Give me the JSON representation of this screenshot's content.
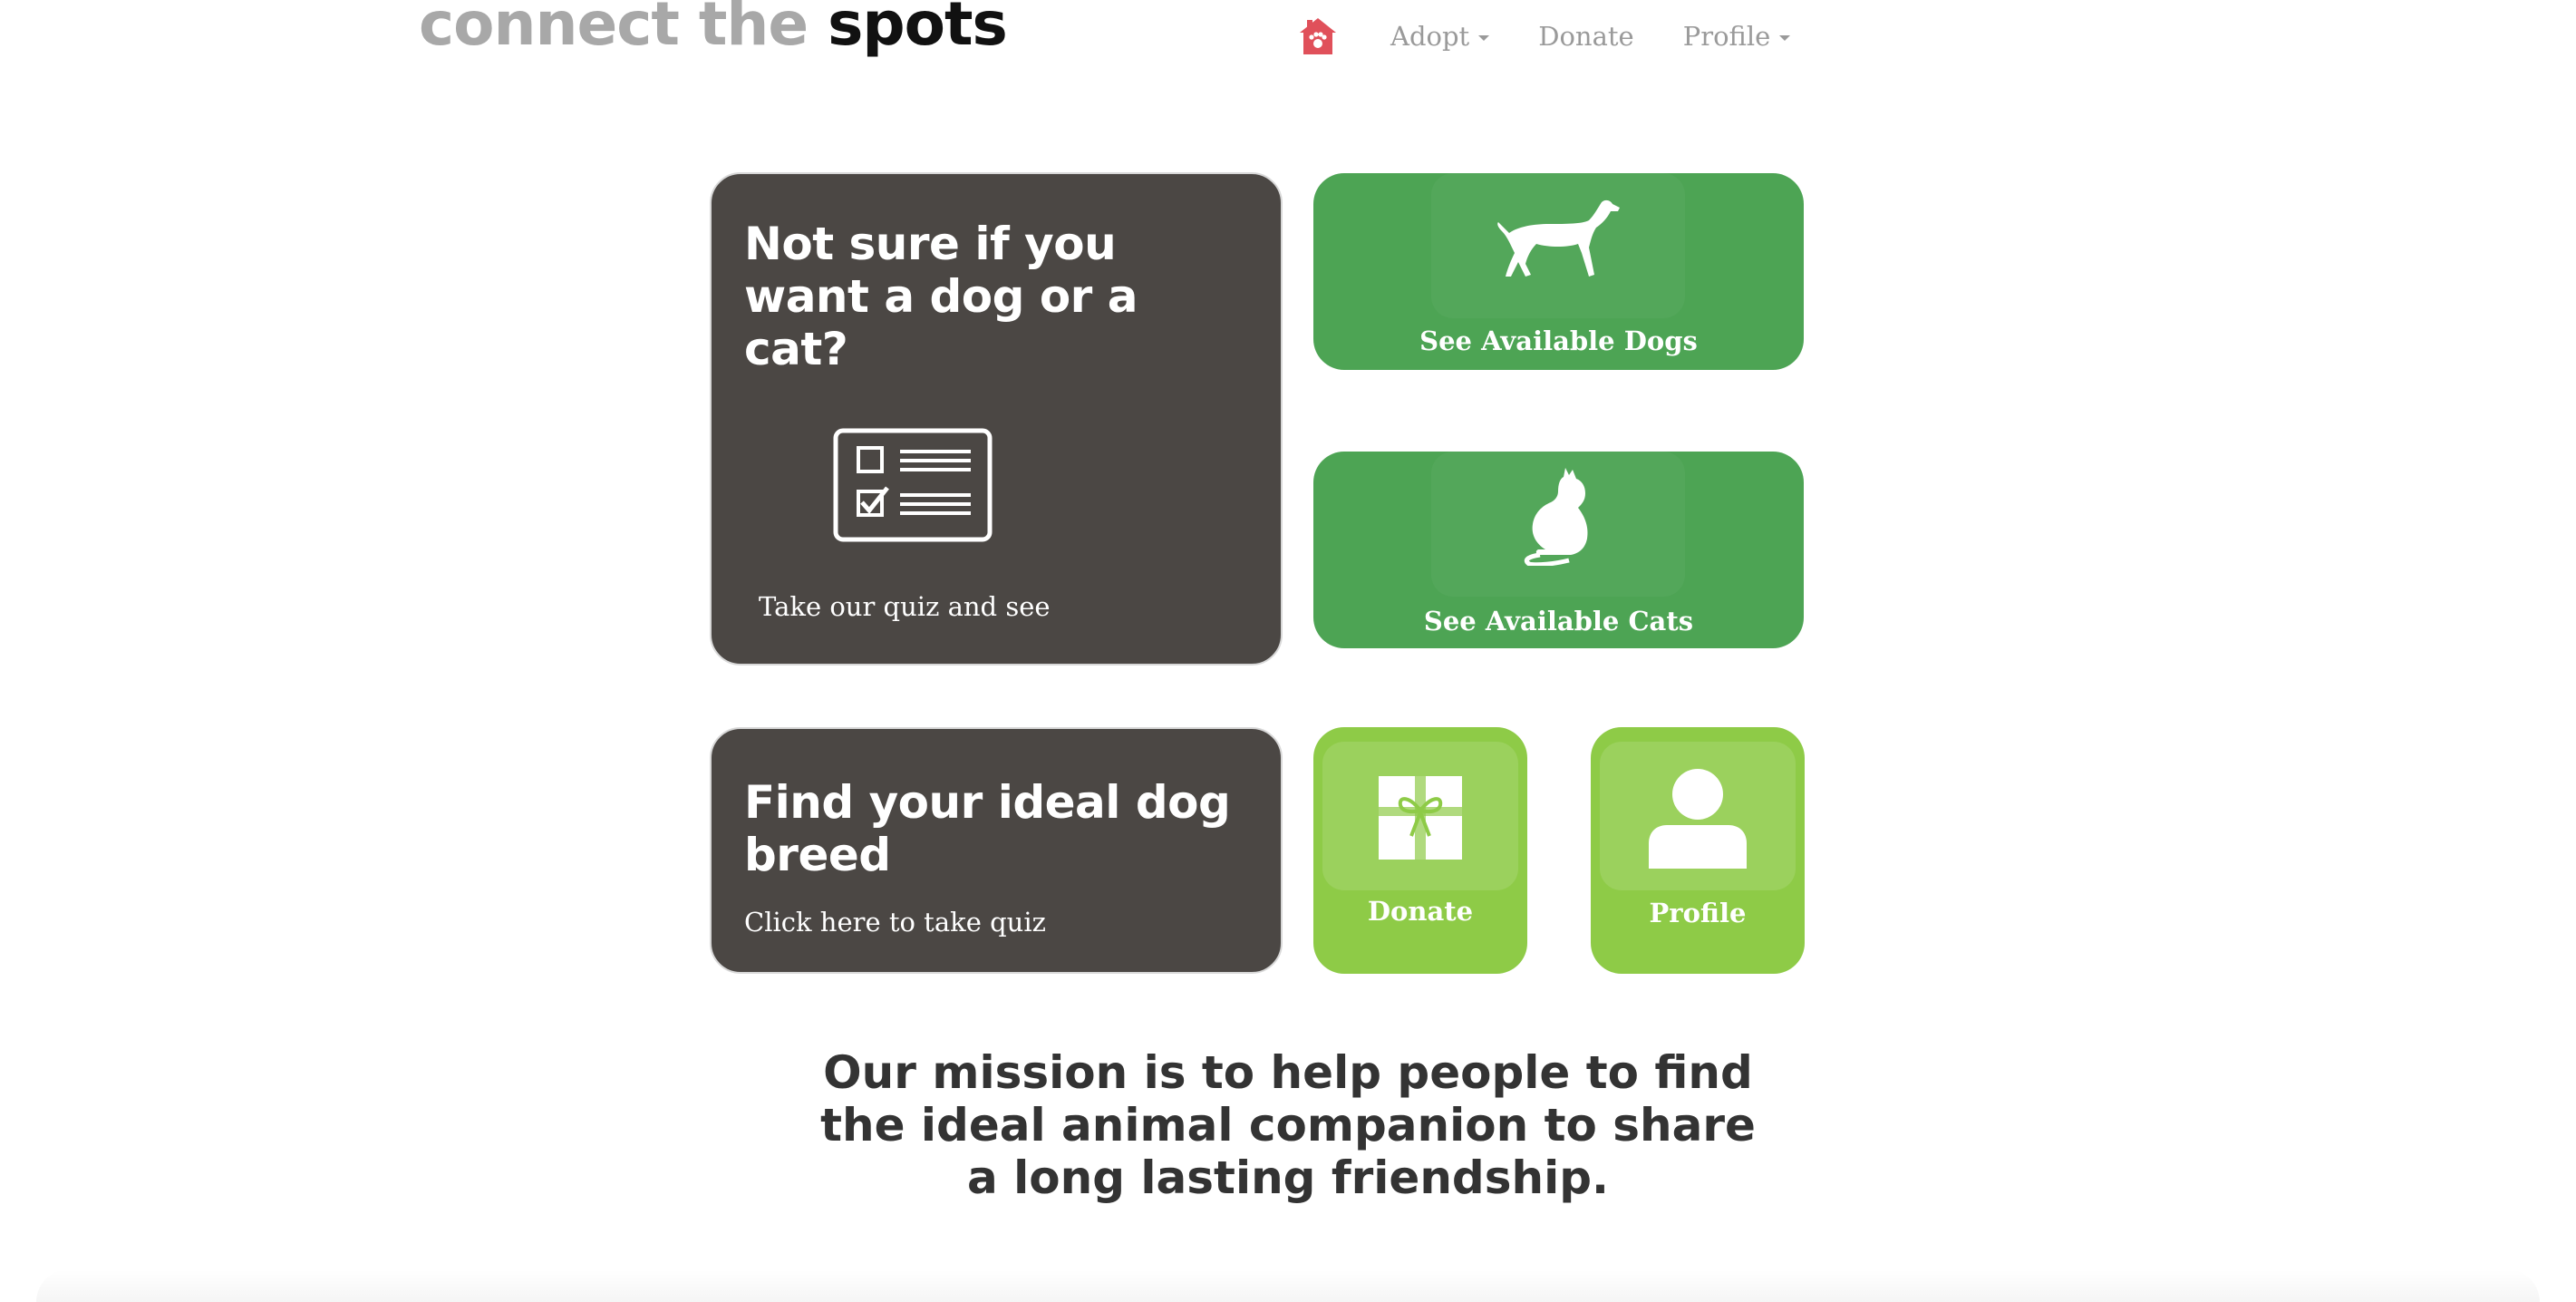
{
  "header": {
    "brand_light": "connect the",
    "brand_dark": "spots",
    "nav": {
      "home_icon": "house-paw-icon",
      "adopt_label": "Adopt",
      "donate_label": "Donate",
      "profile_label": "Profile"
    }
  },
  "cards": {
    "quiz_pet": {
      "heading": "Not sure if you want a dog or a cat?",
      "subtext": "Take our quiz and see",
      "icon": "checklist-icon"
    },
    "dogs": {
      "label": "See Available Dogs",
      "icon": "dog-icon"
    },
    "cats": {
      "label": "See Available Cats",
      "icon": "cat-icon"
    },
    "quiz_breed": {
      "heading": "Find your ideal dog breed",
      "subtext": "Click here to take quiz"
    },
    "donate": {
      "label": "Donate",
      "icon": "gift-icon"
    },
    "profile": {
      "label": "Profile",
      "icon": "user-icon"
    }
  },
  "mission": {
    "line1": "Our mission is to help people to find",
    "line2": "the ideal animal companion to share",
    "line3": "a long lasting friendship."
  },
  "colors": {
    "dark_card": "#4b4744",
    "green_card": "#4da454",
    "lime_card": "#8ecb47",
    "home_icon": "#e0505a",
    "nav_text": "#9a9a9a"
  }
}
